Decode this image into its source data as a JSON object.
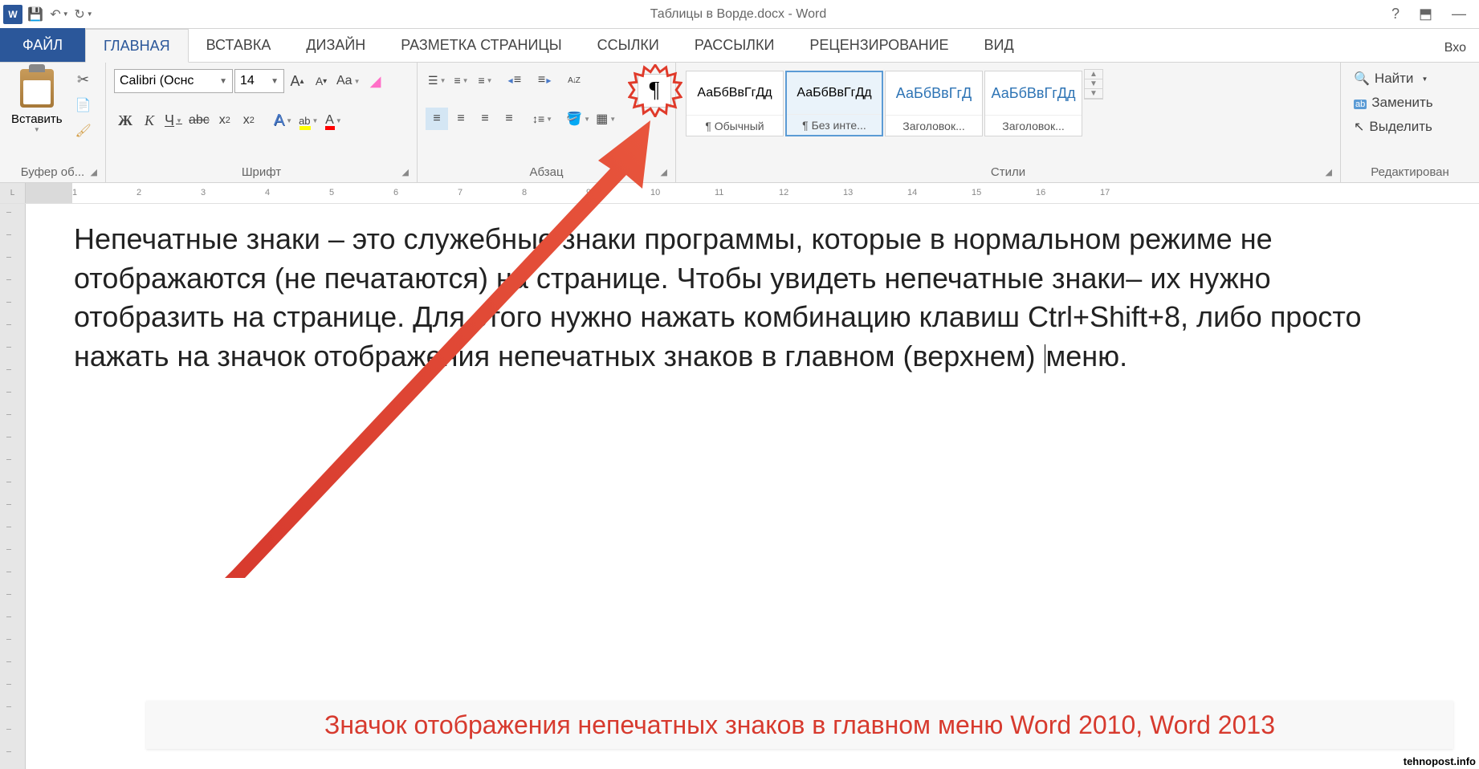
{
  "title": "Таблицы в Ворде.docx - Word",
  "qat": {
    "save": "💾",
    "undo": "↶",
    "redo": "↻"
  },
  "tabs": {
    "file": "ФАЙЛ",
    "items": [
      "ГЛАВНАЯ",
      "ВСТАВКА",
      "ДИЗАЙН",
      "РАЗМЕТКА СТРАНИЦЫ",
      "ССЫЛКИ",
      "РАССЫЛКИ",
      "РЕЦЕНЗИРОВАНИЕ",
      "ВИД"
    ],
    "right": "Вхо"
  },
  "clipboard": {
    "paste": "Вставить",
    "label": "Буфер об..."
  },
  "font": {
    "name": "Calibri (Оснс",
    "size": "14",
    "bold": "Ж",
    "italic": "К",
    "underline": "Ч",
    "strike": "abc",
    "sub": "x",
    "sup": "x",
    "case": "Aa",
    "clear": "◢",
    "label": "Шрифт"
  },
  "paragraph": {
    "label": "Абзац",
    "pilcrow": "¶"
  },
  "styles": {
    "items": [
      {
        "preview": "АаБбВвГгДд",
        "name": "¶ Обычный",
        "cls": ""
      },
      {
        "preview": "АаБбВвГгДд",
        "name": "¶ Без инте...",
        "cls": ""
      },
      {
        "preview": "АаБбВвГгД",
        "name": "Заголовок...",
        "cls": "h1-prev"
      },
      {
        "preview": "АаБбВвГгДд",
        "name": "Заголовок...",
        "cls": "h1-prev"
      }
    ],
    "label": "Стили"
  },
  "editing": {
    "find": "Найти",
    "replace": "Заменить",
    "select": "Выделить",
    "label": "Редактирован"
  },
  "ruler_numbers": [
    "1",
    "2",
    "3",
    "4",
    "5",
    "6",
    "7",
    "8",
    "9",
    "10",
    "11",
    "12",
    "13",
    "14",
    "15",
    "16",
    "17"
  ],
  "document": {
    "p1": "Непечатные знаки – это служебные знаки программы, которые в нормальном режиме не отображаются (не печатаются) на странице. Чтобы увидеть непечатные знаки– их нужно отобразить на странице. Для этого нужно нажать комбинацию клавиш Ctrl+Shift+8, либо просто нажать на значок отображения непечатных знаков в главном (верхнем) ",
    "p1_tail": "меню."
  },
  "caption": "Значок отображения непечатных знаков в главном меню Word 2010, Word   2013",
  "watermark": "tehnopost.info",
  "win": {
    "help": "?",
    "ribbon": "⬒",
    "min": "—"
  }
}
